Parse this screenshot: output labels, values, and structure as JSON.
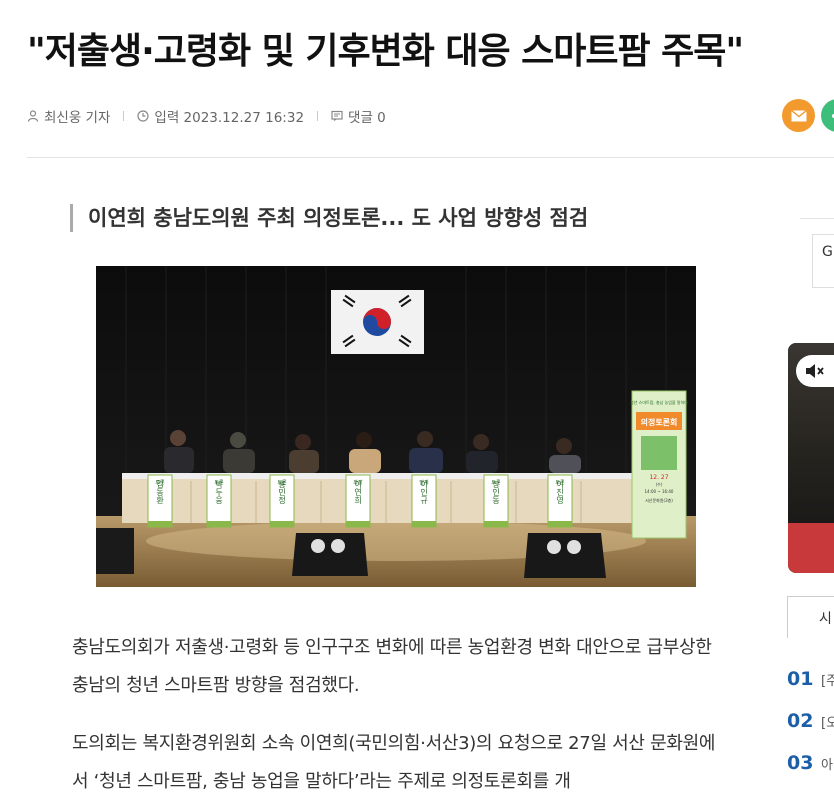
{
  "article": {
    "headline": "\"저출생·고령화 및 기후변화 대응 스마트팜 주목\"",
    "meta": {
      "author": "최신웅 기자",
      "date": "입력 2023.12.27 16:32",
      "comments": "댓글 0"
    },
    "subhead": "이연희 충남도의원 주최 의정토론... 도 사업 방향성 점검",
    "paragraphs": [
      "충남도의회가 저출생·고령화 등 인구구조 변화에 따른 농업환경 변화 대안으로 급부상한 충남의 청년 스마트팜 방향을 점검했다.",
      "도의회는 복지환경위원회 소속 이연희(국민의힘·서산3)의 요청으로 27일 서산 문화원에서 ‘청년 스마트팜, 충남 농업을 말하다’라는 주제로 의정토론회를 개"
    ]
  },
  "photo": {
    "nameplates": [
      {
        "role": "토론",
        "name": "김동환"
      },
      {
        "role": "토론",
        "name": "박두웅"
      },
      {
        "role": "토론",
        "name": "홍민정"
      },
      {
        "role": "좌장",
        "name": "이연희"
      },
      {
        "role": "발제",
        "name": "이인규"
      },
      {
        "role": "토론",
        "name": "장인동"
      },
      {
        "role": "토론",
        "name": "이진영"
      }
    ],
    "banner": {
      "top": "청년 스마트팜, 충남 농업을 말하다",
      "title": "의정토론회",
      "date": "12. 27",
      "day": "(수)",
      "time": "14:00 ~ 16:40",
      "venue": "서산문화원(3층)"
    }
  },
  "share": {
    "icons": [
      "mail-icon",
      "share-icon"
    ]
  },
  "sidebar": {
    "input_text": "G",
    "tab_label": "시",
    "ranks": [
      {
        "num": "01",
        "text": "[주"
      },
      {
        "num": "02",
        "text": "[오"
      },
      {
        "num": "03",
        "text": "아"
      }
    ]
  }
}
